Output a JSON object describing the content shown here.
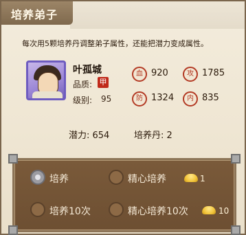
{
  "header": {
    "title": "培养弟子"
  },
  "description": "每次用5颗培养丹调整弟子属性，还能把潜力变成属性。",
  "disciple": {
    "name": "叶孤城",
    "quality_label": "品质:",
    "quality_badge": "甲",
    "level_label": "级别:",
    "level_value": "95"
  },
  "stats": [
    {
      "icon_char": "血",
      "value": "920"
    },
    {
      "icon_char": "攻",
      "value": "1785"
    },
    {
      "icon_char": "防",
      "value": "1324"
    },
    {
      "icon_char": "内",
      "value": "835"
    }
  ],
  "resources": {
    "potential_label": "潜力: 654",
    "pill_label": "培养丹: 2"
  },
  "options": [
    {
      "label": "培养",
      "selected": true
    },
    {
      "label": "精心培养",
      "selected": false,
      "cost": "1",
      "cost_icon": "gold-ingot-icon"
    },
    {
      "label": "培养10次",
      "selected": false
    },
    {
      "label": "精心培养10次",
      "selected": false,
      "cost": "10",
      "cost_icon": "gold-ingot-icon"
    }
  ],
  "colors": {
    "header_bg": "#8a7356",
    "panel_bg": "#74553a",
    "stat_icon": "#b33a24",
    "avatar_border": "#6e5cc0"
  }
}
